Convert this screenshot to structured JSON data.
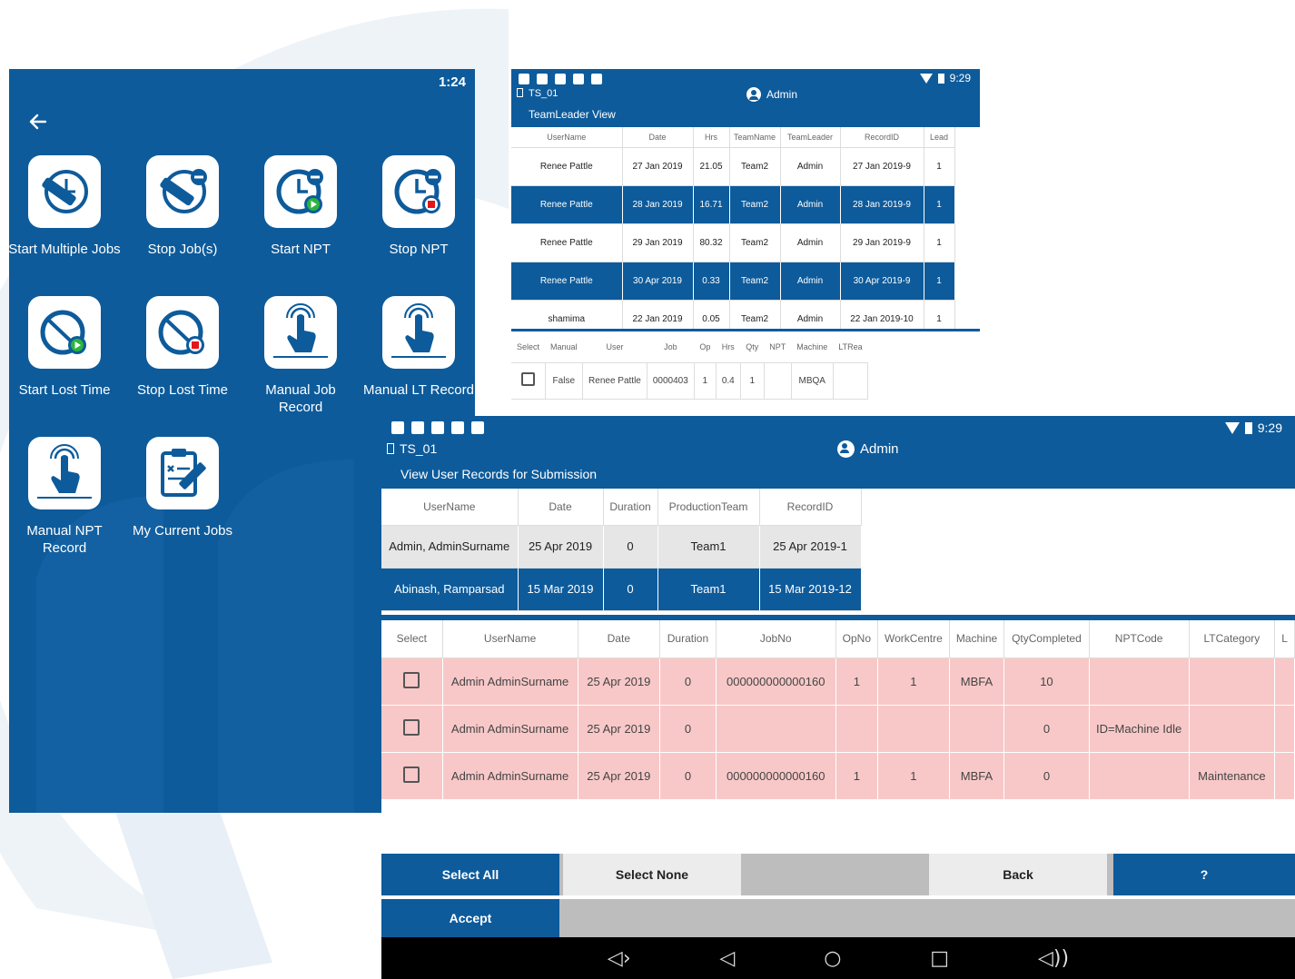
{
  "menu_screen": {
    "status_time": "1:24",
    "tiles": [
      {
        "label": "Start Multiple Jobs",
        "icon": "pencil-clock-icon"
      },
      {
        "label": "Stop Job(s)",
        "icon": "pencil-clock-stop-icon"
      },
      {
        "label": "Start NPT",
        "icon": "clock-play-icon"
      },
      {
        "label": "Stop NPT",
        "icon": "clock-stop-icon"
      },
      {
        "label": "Start Lost Time",
        "icon": "crossed-clock-play-icon"
      },
      {
        "label": "Stop Lost Time",
        "icon": "crossed-clock-stop-icon"
      },
      {
        "label": "Manual Job Record",
        "icon": "hand-tap-icon"
      },
      {
        "label": "Manual LT Record",
        "icon": "hand-tap-icon"
      },
      {
        "label": "Manual NPT Record",
        "icon": "hand-tap-icon"
      },
      {
        "label": "My Current Jobs",
        "icon": "clipboard-edit-icon"
      }
    ]
  },
  "teamleader_screen": {
    "status_time": "9:29",
    "device": "TS_01",
    "user": "Admin",
    "title": "TeamLeader View",
    "top_headers": [
      "UserName",
      "Date",
      "Hrs",
      "TeamName",
      "TeamLeader",
      "RecordID",
      "Lead"
    ],
    "top_rows": [
      {
        "cells": [
          "Renee Pattle",
          "27 Jan 2019",
          "21.05",
          "Team2",
          "Admin",
          "27 Jan 2019-9",
          "1"
        ],
        "selected": false
      },
      {
        "cells": [
          "Renee Pattle",
          "28 Jan 2019",
          "16.71",
          "Team2",
          "Admin",
          "28 Jan 2019-9",
          "1"
        ],
        "selected": true
      },
      {
        "cells": [
          "Renee Pattle",
          "29 Jan 2019",
          "80.32",
          "Team2",
          "Admin",
          "29 Jan 2019-9",
          "1"
        ],
        "selected": false
      },
      {
        "cells": [
          "Renee Pattle",
          "30 Apr 2019",
          "0.33",
          "Team2",
          "Admin",
          "30 Apr 2019-9",
          "1"
        ],
        "selected": true
      },
      {
        "cells": [
          "shamima",
          "22 Jan 2019",
          "0.05",
          "Team2",
          "Admin",
          "22 Jan 2019-10",
          "1"
        ],
        "selected": false
      }
    ],
    "bottom_headers": [
      "Select",
      "Manual",
      "User",
      "Job",
      "Op",
      "Hrs",
      "Qty",
      "NPT",
      "Machine",
      "LTRea"
    ],
    "bottom_rows": [
      {
        "cells": [
          "",
          "False",
          "Renee Pattle",
          "0000403",
          "1",
          "0.4",
          "1",
          "",
          "MBQA",
          ""
        ]
      }
    ]
  },
  "records_screen": {
    "status_time": "9:29",
    "device": "TS_01",
    "user": "Admin",
    "title": "View User Records for Submission",
    "top_headers": [
      "UserName",
      "Date",
      "Duration",
      "ProductionTeam",
      "RecordID"
    ],
    "top_rows": [
      {
        "cells": [
          "Admin, AdminSurname",
          "25 Apr 2019",
          "0",
          "Team1",
          "25 Apr 2019-1"
        ],
        "state": "gray"
      },
      {
        "cells": [
          "Abinash, Ramparsad",
          "15 Mar 2019",
          "0",
          "Team1",
          "15 Mar 2019-12"
        ],
        "state": "sel"
      }
    ],
    "bottom_headers": [
      "Select",
      "UserName",
      "Date",
      "Duration",
      "JobNo",
      "OpNo",
      "WorkCentre",
      "Machine",
      "QtyCompleted",
      "NPTCode",
      "LTCategory",
      "L"
    ],
    "bottom_rows": [
      {
        "cells": [
          "",
          "Admin AdminSurname",
          "25 Apr 2019",
          "0",
          "000000000000160",
          "1",
          "1",
          "MBFA",
          "10",
          "",
          "",
          ""
        ]
      },
      {
        "cells": [
          "",
          "Admin AdminSurname",
          "25 Apr 2019",
          "0",
          "",
          "",
          "",
          "",
          "0",
          "ID=Machine Idle",
          "",
          ""
        ]
      },
      {
        "cells": [
          "",
          "Admin AdminSurname",
          "25 Apr 2019",
          "0",
          "000000000000160",
          "1",
          "1",
          "MBFA",
          "0",
          "",
          "Maintenance",
          ""
        ]
      }
    ],
    "buttons": {
      "select_all": "Select All",
      "select_none": "Select None",
      "back": "Back",
      "help": "?",
      "accept": "Accept"
    },
    "nav": [
      "volume-down-icon",
      "back-triangle-icon",
      "home-circle-icon",
      "recents-square-icon",
      "volume-up-icon"
    ]
  },
  "colors": {
    "brand_blue": "#0d5b9b",
    "row_pink": "#f8c8c8",
    "row_gray": "#e6e6e6"
  }
}
